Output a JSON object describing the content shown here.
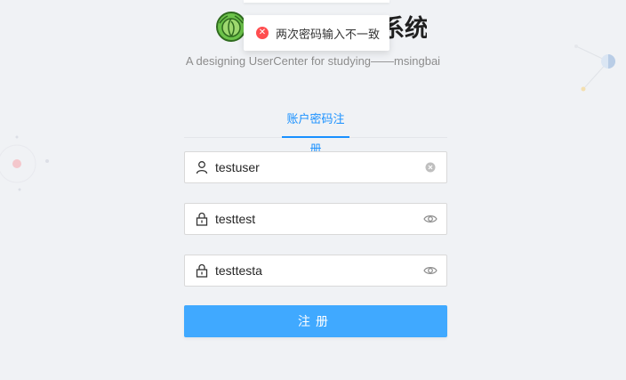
{
  "header": {
    "title": "系统",
    "subtitle": "A designing UserCenter for studying——msingbai",
    "logo_icon": "cabbage-logo-icon"
  },
  "toast": {
    "type": "error",
    "icon": "error-circle-icon",
    "message": "两次密码输入不一致"
  },
  "tabs": [
    {
      "label": "账户密码注册",
      "active": true
    }
  ],
  "form": {
    "username": {
      "value": "testuser",
      "prefix_icon": "user-icon",
      "suffix_icon": "clear-icon"
    },
    "password": {
      "value": "testtest",
      "prefix_icon": "lock-icon",
      "suffix_icon": "eye-icon"
    },
    "confirm_password": {
      "value": "testtesta",
      "prefix_icon": "lock-icon",
      "suffix_icon": "eye-icon"
    },
    "submit_label": "注册"
  },
  "colors": {
    "primary": "#1890ff",
    "button": "#40a9ff",
    "error": "#ff4d4f",
    "background": "#f0f2f5"
  }
}
